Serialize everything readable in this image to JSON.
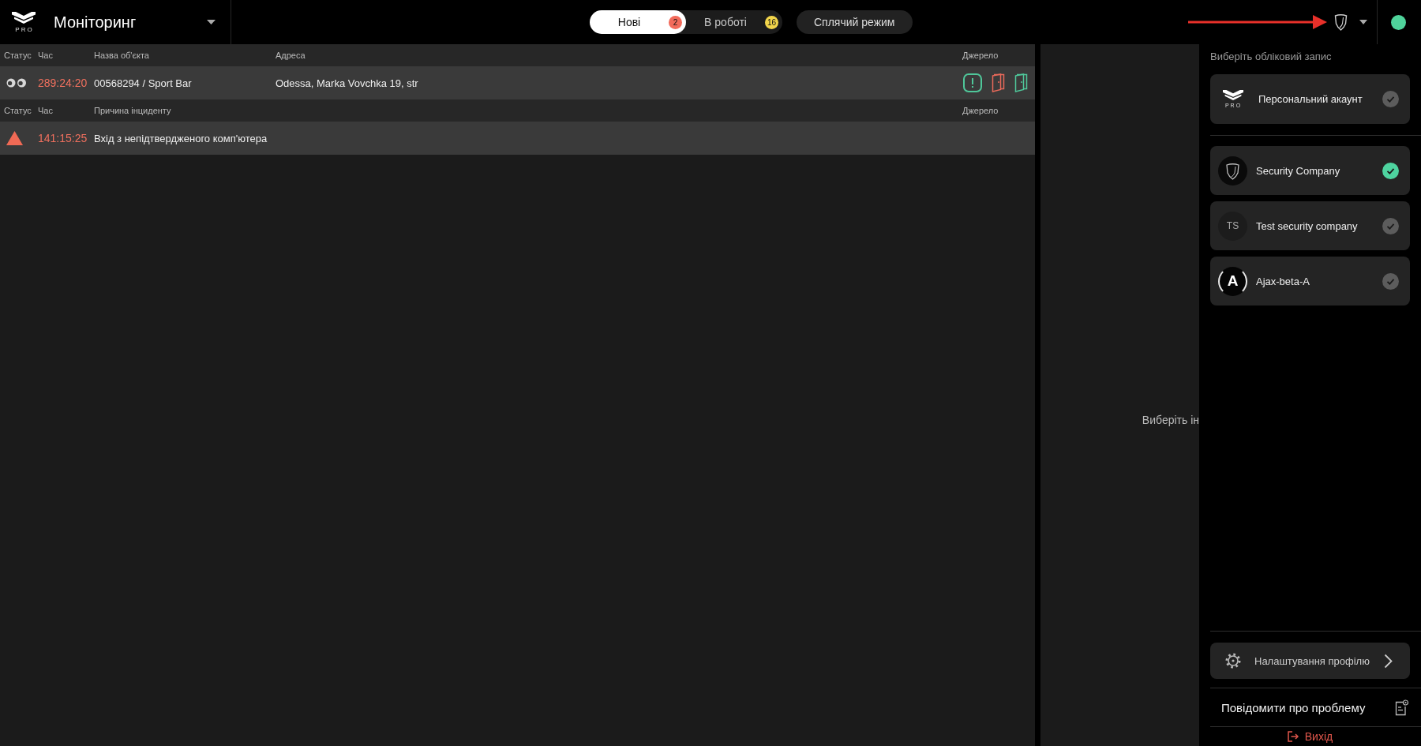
{
  "header": {
    "logo_text": "PRO",
    "title": "Моніторинг",
    "tabs": [
      {
        "label": "Нові",
        "badge": "2",
        "color": "#f26b5b",
        "selected": true
      },
      {
        "label": "В роботі",
        "badge": "16",
        "color": "#f2d54b",
        "selected": false
      }
    ],
    "mode_button": {
      "label": "Сплячий режим"
    },
    "connection": {
      "online": true
    }
  },
  "sections": [
    {
      "columns": [
        "Статус",
        "Час",
        "Назва об'єкта",
        "Адреса",
        "Джерело"
      ],
      "rows": [
        {
          "kind": "watching",
          "cells": [
            "",
            "289:24:20",
            "00568294 / Sport Bar",
            "Odessa, Marka Vovchka 19, str"
          ],
          "sources": [
            {
              "kind": "alert",
              "color": "#4fc79a"
            },
            {
              "kind": "door",
              "color": "#e8695a"
            },
            {
              "kind": "door",
              "color": "#4fc79a"
            }
          ]
        }
      ]
    },
    {
      "columns": [
        "Статус",
        "Час",
        "Причина інциденту",
        "Джерело"
      ],
      "rows": [
        {
          "kind": "alarm",
          "cells": [
            "",
            "141:15:25",
            "Вхід з непідтвердженого комп'ютера"
          ]
        }
      ]
    }
  ],
  "detail_panel": {
    "message": "Виберіть ін"
  },
  "account_menu": {
    "heading": "Виберіть обліковий запис",
    "personal": {
      "logo_text": "PRO",
      "name": "Персональний акаунт",
      "selected": false
    },
    "companies": [
      {
        "avatar": {
          "kind": "shield"
        },
        "name": "Security Company",
        "selected": true
      },
      {
        "avatar": {
          "kind": "initials",
          "text": "TS"
        },
        "name": "Test security company",
        "selected": false
      },
      {
        "avatar": {
          "kind": "letter",
          "text": "A"
        },
        "name": "Ajax-beta-A",
        "selected": false
      }
    ],
    "settings": {
      "label": "Налаштування профілю"
    },
    "report": {
      "label": "Повідомити про проблему"
    },
    "logout": {
      "label": "Вихід"
    }
  }
}
